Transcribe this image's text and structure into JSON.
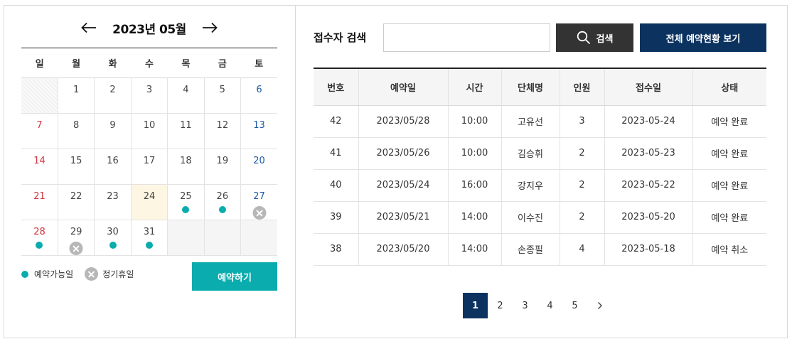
{
  "calendar": {
    "month_label": "2023년 05월",
    "weekdays": [
      "일",
      "월",
      "화",
      "수",
      "목",
      "금",
      "토"
    ],
    "weeks": [
      [
        {
          "day": ""
        },
        {
          "day": "1"
        },
        {
          "day": "2"
        },
        {
          "day": "3"
        },
        {
          "day": "4"
        },
        {
          "day": "5"
        },
        {
          "day": "6"
        }
      ],
      [
        {
          "day": "7"
        },
        {
          "day": "8"
        },
        {
          "day": "9"
        },
        {
          "day": "10"
        },
        {
          "day": "11"
        },
        {
          "day": "12"
        },
        {
          "day": "13"
        }
      ],
      [
        {
          "day": "14"
        },
        {
          "day": "15"
        },
        {
          "day": "16"
        },
        {
          "day": "17"
        },
        {
          "day": "18"
        },
        {
          "day": "19"
        },
        {
          "day": "20"
        }
      ],
      [
        {
          "day": "21"
        },
        {
          "day": "22"
        },
        {
          "day": "23"
        },
        {
          "day": "24",
          "today": true
        },
        {
          "day": "25",
          "status": "available"
        },
        {
          "day": "26",
          "status": "available"
        },
        {
          "day": "27",
          "status": "closed"
        }
      ],
      [
        {
          "day": "28",
          "status": "available"
        },
        {
          "day": "29",
          "status": "closed"
        },
        {
          "day": "30",
          "status": "available"
        },
        {
          "day": "31",
          "status": "available"
        },
        {
          "day": ""
        },
        {
          "day": ""
        },
        {
          "day": ""
        }
      ]
    ]
  },
  "legend": {
    "available_label": "예약가능일",
    "closed_label": "정기휴일"
  },
  "reserve_button_label": "예약하기",
  "search": {
    "label": "접수자 검색",
    "value": "",
    "placeholder": "",
    "button_label": "검색",
    "all_button_label": "전체 예약현황 보기"
  },
  "table": {
    "columns": [
      "번호",
      "예약일",
      "시간",
      "단체명",
      "인원",
      "접수일",
      "상태"
    ],
    "rows": [
      [
        "42",
        "2023/05/28",
        "10:00",
        "고유선",
        "3",
        "2023-05-24",
        "예약 완료"
      ],
      [
        "41",
        "2023/05/26",
        "10:00",
        "김승휘",
        "2",
        "2023-05-23",
        "예약 완료"
      ],
      [
        "40",
        "2023/05/24",
        "16:00",
        "강지우",
        "2",
        "2023-05-22",
        "예약 완료"
      ],
      [
        "39",
        "2023/05/21",
        "14:00",
        "이수진",
        "2",
        "2023-05-20",
        "예약 완료"
      ],
      [
        "38",
        "2023/05/20",
        "14:00",
        "손종필",
        "4",
        "2023-05-18",
        "예약 취소"
      ]
    ]
  },
  "pagination": {
    "pages": [
      "1",
      "2",
      "3",
      "4",
      "5"
    ],
    "current": "1"
  },
  "colors": {
    "accent_teal": "#0aacad",
    "navy": "#0c3360",
    "dark_button": "#333333",
    "sunday": "#d2333a",
    "saturday": "#1c5aa8",
    "today_bg": "#fdf6e3",
    "closed_grey": "#b7b7b7"
  },
  "icons": {
    "prev_month": "arrow-left-icon",
    "next_month": "arrow-right-icon",
    "search": "search-icon",
    "available": "dot-icon",
    "closed": "x-circle-icon",
    "next_page": "chevron-right-icon"
  }
}
